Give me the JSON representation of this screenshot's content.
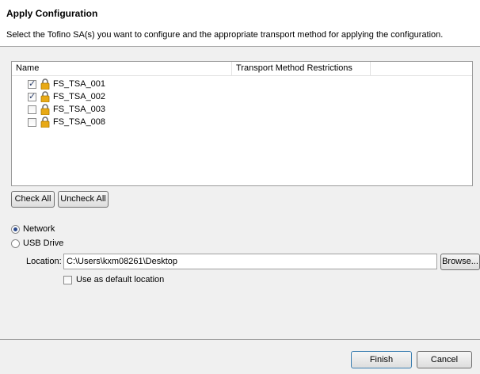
{
  "header": {
    "title": "Apply Configuration",
    "description": "Select the Tofino SA(s) you want to configure and the appropriate transport method for applying the configuration."
  },
  "table": {
    "columns": [
      "Name",
      "Transport Method Restrictions"
    ],
    "rows": [
      {
        "name": "FS_TSA_001",
        "checked": true,
        "icon": "lock-icon"
      },
      {
        "name": "FS_TSA_002",
        "checked": true,
        "icon": "lock-icon"
      },
      {
        "name": "FS_TSA_003",
        "checked": false,
        "icon": "lock-icon"
      },
      {
        "name": "FS_TSA_008",
        "checked": false,
        "icon": "lock-icon"
      }
    ]
  },
  "actions": {
    "check_all": "Check All",
    "uncheck_all": "Uncheck All"
  },
  "transport": {
    "network_label": "Network",
    "network_selected": true,
    "usb_label": "USB Drive",
    "usb_selected": false,
    "location_label": "Location:",
    "location_value": "C:\\Users\\kxm08261\\Desktop",
    "browse_label": "Browse...",
    "default_label": "Use as default location",
    "default_checked": false
  },
  "footer": {
    "finish_label": "Finish",
    "cancel_label": "Cancel"
  },
  "colors": {
    "header_bg": "#ffffff",
    "dialog_bg": "#f0f0f0",
    "check_mark": "#2c3f6c",
    "lock_body": "#e8a915"
  }
}
